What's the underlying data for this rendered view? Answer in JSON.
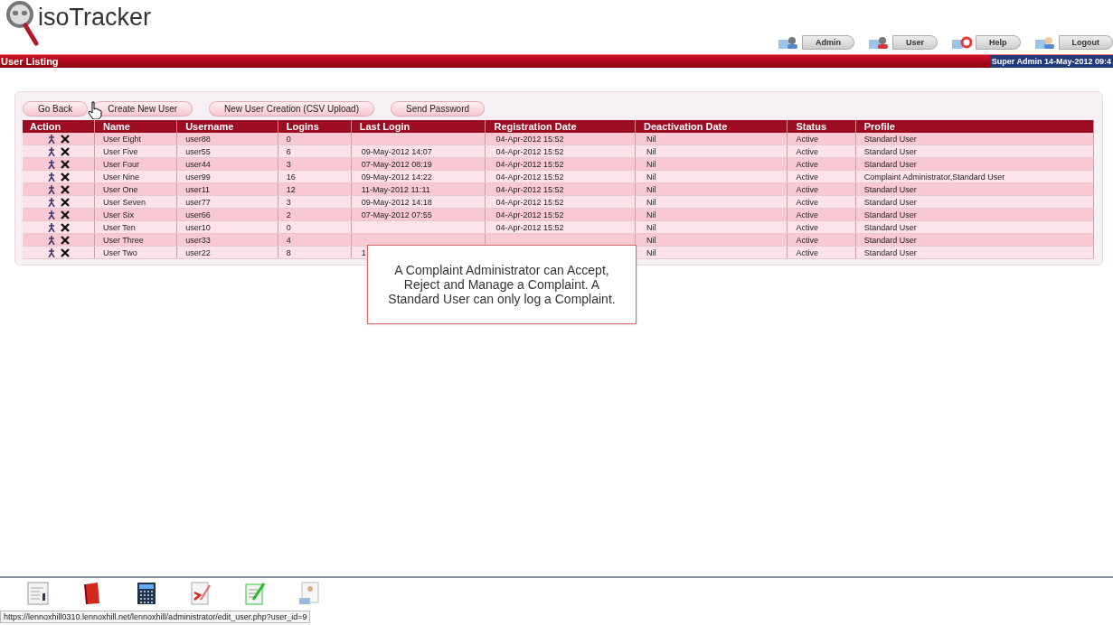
{
  "logo": {
    "text": "isoTracker"
  },
  "nav": [
    {
      "label": "Admin",
      "kind": "admin"
    },
    {
      "label": "User",
      "kind": "user"
    },
    {
      "label": "Help",
      "kind": "help"
    },
    {
      "label": "Logout",
      "kind": "logout"
    }
  ],
  "title_bar": {
    "title": "User Listing",
    "session": "Super Admin  14-May-2012 09:4"
  },
  "buttons": [
    "Go Back",
    "Create New User",
    "New User Creation (CSV Upload)",
    "Send Password"
  ],
  "table": {
    "columns": [
      "Action",
      "Name",
      "Username",
      "Logins",
      "Last Login",
      "Registration Date",
      "Deactivation Date",
      "Status",
      "Profile"
    ],
    "rows": [
      {
        "name": "User Eight",
        "username": "user88",
        "logins": "0",
        "registration_date": "04-Apr-2012 15:52",
        "deactivation_date": "Nil",
        "status": "Active",
        "profile": "Standard User"
      },
      {
        "name": "User Five",
        "username": "user55",
        "logins": "6",
        "last_login": "09-May-2012 14:07",
        "registration_date": "04-Apr-2012 15:52",
        "deactivation_date": "Nil",
        "status": "Active",
        "profile": "Standard User"
      },
      {
        "name": "User Four",
        "username": "user44",
        "logins": "3",
        "last_login": "07-May-2012 08:19",
        "registration_date": "04-Apr-2012 15:52",
        "deactivation_date": "Nil",
        "status": "Active",
        "profile": "Standard User"
      },
      {
        "name": "User Nine",
        "username": "user99",
        "logins": "16",
        "last_login": "09-May-2012 14:22",
        "registration_date": "04-Apr-2012 15:52",
        "deactivation_date": "Nil",
        "status": "Active",
        "profile": "Complaint Administrator,Standard User"
      },
      {
        "name": "User One",
        "username": "user11",
        "logins": "12",
        "last_login": "11-May-2012 11:11",
        "registration_date": "04-Apr-2012 15:52",
        "deactivation_date": "Nil",
        "status": "Active",
        "profile": "Standard User"
      },
      {
        "name": "User Seven",
        "username": "user77",
        "logins": "3",
        "last_login": "09-May-2012 14:18",
        "registration_date": "04-Apr-2012 15:52",
        "deactivation_date": "Nil",
        "status": "Active",
        "profile": "Standard User"
      },
      {
        "name": "User Six",
        "username": "user66",
        "logins": "2",
        "last_login": "07-May-2012 07:55",
        "registration_date": "04-Apr-2012 15:52",
        "deactivation_date": "Nil",
        "status": "Active",
        "profile": "Standard User"
      },
      {
        "name": "User Ten",
        "username": "user10",
        "logins": "0",
        "registration_date": "04-Apr-2012 15:52",
        "deactivation_date": "Nil",
        "status": "Active",
        "profile": "Standard User"
      },
      {
        "name": "User Three",
        "username": "user33",
        "logins": "4",
        "deactivation_date": "Nil",
        "status": "Active",
        "profile": "Standard User"
      },
      {
        "name": "User Two",
        "username": "user22",
        "logins": "8",
        "last_login": "1",
        "deactivation_date": "Nil",
        "status": "Active",
        "profile": "Standard User"
      }
    ]
  },
  "callout": {
    "text": "A Complaint Administrator can Accept, Reject and Manage a Complaint. A Standard User can only log a Complaint."
  },
  "dock": [
    {
      "kind": "document"
    },
    {
      "kind": "book"
    },
    {
      "kind": "calculator"
    },
    {
      "kind": "signature"
    },
    {
      "kind": "notepad"
    },
    {
      "kind": "contact"
    }
  ],
  "status_url": "https://lennoxhill0310.lennoxhill.net/lennoxhill/administrator/edit_user.php?user_id=9"
}
